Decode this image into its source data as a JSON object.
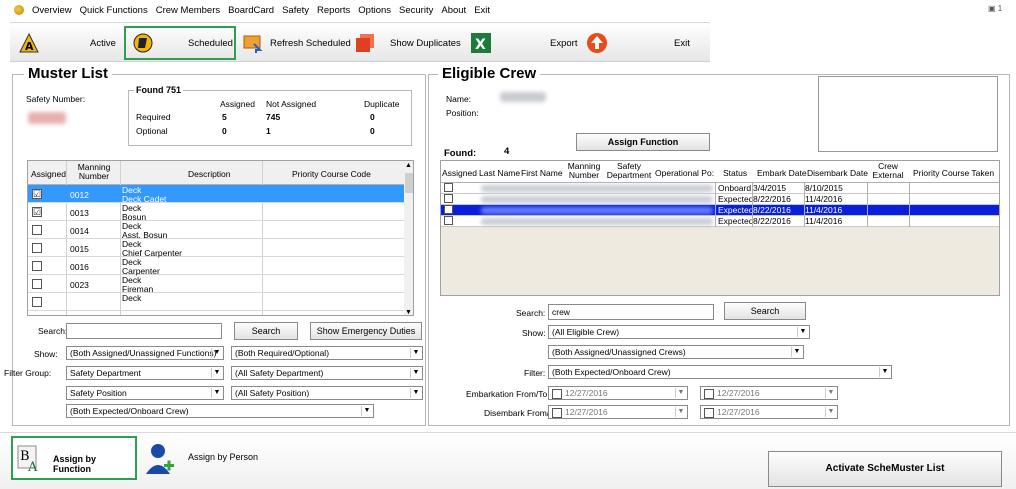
{
  "menu": {
    "items": [
      "Overview",
      "Quick Functions",
      "Crew Members",
      "BoardCard",
      "Safety",
      "Reports",
      "Options",
      "Security",
      "About",
      "Exit"
    ],
    "window_controls": "7 1"
  },
  "toolbar": {
    "active": "Active",
    "scheduled": "Scheduled",
    "refresh_scheduled": "Refresh Scheduled",
    "show_duplicates": "Show Duplicates",
    "export": "Export",
    "exit": "Exit"
  },
  "muster": {
    "title": "Muster List",
    "safety_number_label": "Safety Number:",
    "found_label": "Found 751",
    "col_assigned": "Assigned",
    "col_not_assigned": "Not Assigned",
    "col_duplicate": "Duplicate",
    "required_label": "Required",
    "optional_label": "Optional",
    "required": {
      "assigned": "5",
      "not_assigned": "745",
      "duplicate": "0"
    },
    "optional": {
      "assigned": "0",
      "not_assigned": "1",
      "duplicate": "0"
    },
    "grid_headers": {
      "assigned": "Assigned",
      "manning": "Manning Number",
      "description": "Description",
      "priority": "Priority Course Code"
    },
    "rows": [
      {
        "checked": "☑",
        "num": "0012",
        "d1": "Deck",
        "d2": "Deck Cadet"
      },
      {
        "checked": "☑",
        "num": "0013",
        "d1": "Deck",
        "d2": "Bosun"
      },
      {
        "checked": "",
        "num": "0014",
        "d1": "Deck",
        "d2": "Asst. Bosun"
      },
      {
        "checked": "",
        "num": "0015",
        "d1": "Deck",
        "d2": "Chief Carpenter"
      },
      {
        "checked": "",
        "num": "0016",
        "d1": "Deck",
        "d2": "Carpenter"
      },
      {
        "checked": "",
        "num": "0023",
        "d1": "Deck",
        "d2": "Fireman"
      },
      {
        "checked": "",
        "num": "",
        "d1": "Deck",
        "d2": ""
      }
    ],
    "search_label": "Search:",
    "search_button": "Search",
    "show_emergency_button": "Show Emergency Duties",
    "show_label": "Show:",
    "show_combo": "(Both Assigned/Unassigned Functions)",
    "required_combo": "(Both Required/Optional)",
    "filter_group_label": "Filter Group:",
    "filter_group_combo": "Safety Department",
    "all_dept_combo": "(All Safety Department)",
    "position_combo": "Safety Position",
    "all_pos_combo": "(All Safety Position)",
    "expected_combo": "(Both Expected/Onboard Crew)"
  },
  "eligible": {
    "title": "Eligible Crew",
    "name_label": "Name:",
    "position_label": "Position:",
    "assign_function_button": "Assign Function",
    "found_label": "Found:",
    "found_value": "4",
    "grid_headers": {
      "assigned": "Assigned",
      "last": "Last Name",
      "first": "First Name",
      "manning": "Manning Number",
      "dept": "Safety Department",
      "op": "Operational Po:",
      "status": "Status",
      "embark": "Embark Date",
      "disembark": "Disembark Date",
      "crew_external": "Crew External",
      "priority_taken": "Priority Course Taken"
    },
    "rows": [
      {
        "status": "Onboard",
        "embark": "3/4/2015",
        "disembark": "8/10/2015"
      },
      {
        "status": "Expected",
        "embark": "8/22/2016",
        "disembark": "11/4/2016"
      },
      {
        "status": "Expected",
        "embark": "8/22/2016",
        "disembark": "11/4/2016"
      },
      {
        "status": "Expected",
        "embark": "8/22/2016",
        "disembark": "11/4/2016"
      }
    ],
    "search_label": "Search:",
    "search_value": "crew",
    "search_button": "Search",
    "show_label": "Show:",
    "show_combo": "(All Eligible Crew)",
    "assigned_combo": "(Both Assigned/Unassigned Crews)",
    "filter_label": "Filter:",
    "filter_combo": "(Both Expected/Onboard Crew)",
    "embark_label": "Embarkation From/To:",
    "disembark_label": "Disembark From/To:",
    "date_value": "12/27/2016"
  },
  "bottom": {
    "assign_by_function": "Assign by Function",
    "assign_by_person": "Assign by Person",
    "activate_button": "Activate ScheMuster List"
  },
  "colors": {
    "selection": "#0a1fdc",
    "highlight_green": "#2e9e4f",
    "row_selected": "#3399ff"
  }
}
